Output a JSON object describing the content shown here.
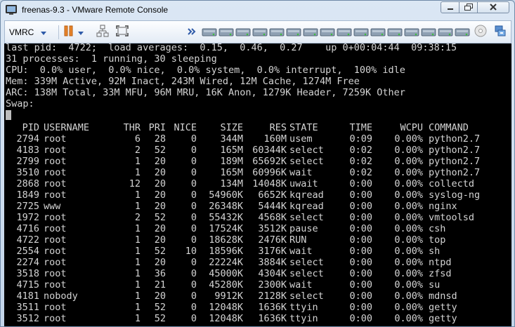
{
  "window": {
    "title": "freenas-9.3 - VMware Remote Console"
  },
  "toolbar": {
    "vmrc_label": "VMRC",
    "drive_icons": [
      "disk-drive",
      "disk-drive",
      "disk-drive",
      "disk-drive",
      "disk-drive",
      "disk-drive",
      "disk-drive",
      "disk-drive",
      "disk-drive",
      "disk-drive",
      "disk-drive",
      "disk-drive",
      "disk-drive",
      "disk-drive",
      "disk-drive",
      "disk-drive"
    ]
  },
  "console": {
    "summary": [
      "last pid:  4722;  load averages:  0.15,  0.46,  0.27    up 0+00:04:44  09:38:15",
      "31 processes:  1 running, 30 sleeping",
      "CPU:  0.0% user,  0.0% nice,  0.0% system,  0.0% interrupt,  100% idle",
      "Mem: 339M Active, 92M Inact, 243M Wired, 12M Cache, 1274M Free",
      "ARC: 138M Total, 33M MFU, 96M MRU, 16K Anon, 1279K Header, 7259K Other",
      "Swap:"
    ],
    "columns": {
      "pid": "PID",
      "username": "USERNAME",
      "thr": "THR",
      "pri": "PRI",
      "nice": "NICE",
      "size": "SIZE",
      "res": "RES",
      "state": "STATE",
      "time": "TIME",
      "wcpu": "WCPU",
      "command": "COMMAND"
    },
    "processes": [
      {
        "pid": "2794",
        "username": "root",
        "thr": "6",
        "pri": "28",
        "nice": "0",
        "size": "344M",
        "res": "160M",
        "state": "usem",
        "time": "0:09",
        "wcpu": "0.00%",
        "command": "python2.7"
      },
      {
        "pid": "4183",
        "username": "root",
        "thr": "2",
        "pri": "52",
        "nice": "0",
        "size": "165M",
        "res": "60344K",
        "state": "select",
        "time": "0:02",
        "wcpu": "0.00%",
        "command": "python2.7"
      },
      {
        "pid": "2799",
        "username": "root",
        "thr": "1",
        "pri": "20",
        "nice": "0",
        "size": "189M",
        "res": "65692K",
        "state": "select",
        "time": "0:02",
        "wcpu": "0.00%",
        "command": "python2.7"
      },
      {
        "pid": "3510",
        "username": "root",
        "thr": "1",
        "pri": "20",
        "nice": "0",
        "size": "165M",
        "res": "60996K",
        "state": "wait",
        "time": "0:02",
        "wcpu": "0.00%",
        "command": "python2.7"
      },
      {
        "pid": "2868",
        "username": "root",
        "thr": "12",
        "pri": "20",
        "nice": "0",
        "size": "134M",
        "res": "14048K",
        "state": "uwait",
        "time": "0:00",
        "wcpu": "0.00%",
        "command": "collectd"
      },
      {
        "pid": "1849",
        "username": "root",
        "thr": "1",
        "pri": "20",
        "nice": "0",
        "size": "54960K",
        "res": "6652K",
        "state": "kqread",
        "time": "0:00",
        "wcpu": "0.00%",
        "command": "syslog-ng"
      },
      {
        "pid": "2725",
        "username": "www",
        "thr": "1",
        "pri": "20",
        "nice": "0",
        "size": "26348K",
        "res": "5444K",
        "state": "kqread",
        "time": "0:00",
        "wcpu": "0.00%",
        "command": "nginx"
      },
      {
        "pid": "1972",
        "username": "root",
        "thr": "2",
        "pri": "52",
        "nice": "0",
        "size": "55432K",
        "res": "4568K",
        "state": "select",
        "time": "0:00",
        "wcpu": "0.00%",
        "command": "vmtoolsd"
      },
      {
        "pid": "4716",
        "username": "root",
        "thr": "1",
        "pri": "20",
        "nice": "0",
        "size": "17524K",
        "res": "3512K",
        "state": "pause",
        "time": "0:00",
        "wcpu": "0.00%",
        "command": "csh"
      },
      {
        "pid": "4722",
        "username": "root",
        "thr": "1",
        "pri": "20",
        "nice": "0",
        "size": "18628K",
        "res": "2476K",
        "state": "RUN",
        "time": "0:00",
        "wcpu": "0.00%",
        "command": "top"
      },
      {
        "pid": "2554",
        "username": "root",
        "thr": "1",
        "pri": "52",
        "nice": "10",
        "size": "18596K",
        "res": "3176K",
        "state": "wait",
        "time": "0:00",
        "wcpu": "0.00%",
        "command": "sh"
      },
      {
        "pid": "2274",
        "username": "root",
        "thr": "1",
        "pri": "20",
        "nice": "0",
        "size": "22224K",
        "res": "3884K",
        "state": "select",
        "time": "0:00",
        "wcpu": "0.00%",
        "command": "ntpd"
      },
      {
        "pid": "3518",
        "username": "root",
        "thr": "1",
        "pri": "36",
        "nice": "0",
        "size": "45000K",
        "res": "4304K",
        "state": "select",
        "time": "0:00",
        "wcpu": "0.00%",
        "command": "zfsd"
      },
      {
        "pid": "4715",
        "username": "root",
        "thr": "1",
        "pri": "21",
        "nice": "0",
        "size": "45280K",
        "res": "2300K",
        "state": "wait",
        "time": "0:00",
        "wcpu": "0.00%",
        "command": "su"
      },
      {
        "pid": "4181",
        "username": "nobody",
        "thr": "1",
        "pri": "20",
        "nice": "0",
        "size": "9912K",
        "res": "2128K",
        "state": "select",
        "time": "0:00",
        "wcpu": "0.00%",
        "command": "mdnsd"
      },
      {
        "pid": "3511",
        "username": "root",
        "thr": "1",
        "pri": "52",
        "nice": "0",
        "size": "12048K",
        "res": "1636K",
        "state": "ttyin",
        "time": "0:00",
        "wcpu": "0.00%",
        "command": "getty"
      },
      {
        "pid": "3512",
        "username": "root",
        "thr": "1",
        "pri": "52",
        "nice": "0",
        "size": "12048K",
        "res": "1636K",
        "state": "ttyin",
        "time": "0:00",
        "wcpu": "0.00%",
        "command": "getty"
      }
    ]
  }
}
